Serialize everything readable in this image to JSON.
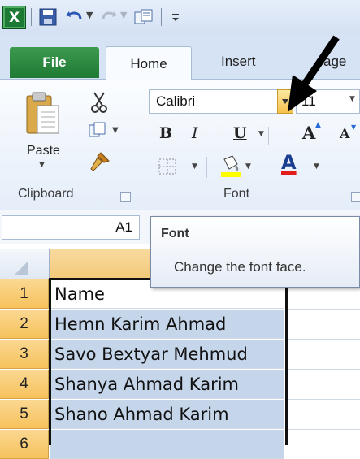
{
  "quick_access": {
    "logo_letter": "X",
    "icons": [
      "excel-logo-icon",
      "save-icon",
      "undo-icon",
      "redo-icon",
      "paste-special-icon",
      "customize-icon"
    ]
  },
  "tabs": {
    "file": "File",
    "home": "Home",
    "insert": "Insert",
    "page_layout_partial": "age"
  },
  "ribbon": {
    "clipboard": {
      "paste_label": "Paste",
      "group_label": "Clipboard"
    },
    "font": {
      "font_name": "Calibri",
      "font_size": "11",
      "bold": "B",
      "italic": "I",
      "underline": "U",
      "grow": "A",
      "shrink": "A",
      "font_color_letter": "A",
      "group_label": "Font",
      "font_color": "#e31c1c",
      "highlight_color": "#ffff00"
    }
  },
  "name_box": "A1",
  "tooltip": {
    "title": "Font",
    "description": "Change the font face."
  },
  "rows": [
    {
      "num": "1",
      "value": "Name"
    },
    {
      "num": "2",
      "value": "Hemn Karim Ahmad"
    },
    {
      "num": "3",
      "value": "Savo Bextyar Mehmud"
    },
    {
      "num": "4",
      "value": "Shanya Ahmad Karim"
    },
    {
      "num": "5",
      "value": "Shano Ahmad Karim"
    },
    {
      "num": "6",
      "value": ""
    }
  ]
}
